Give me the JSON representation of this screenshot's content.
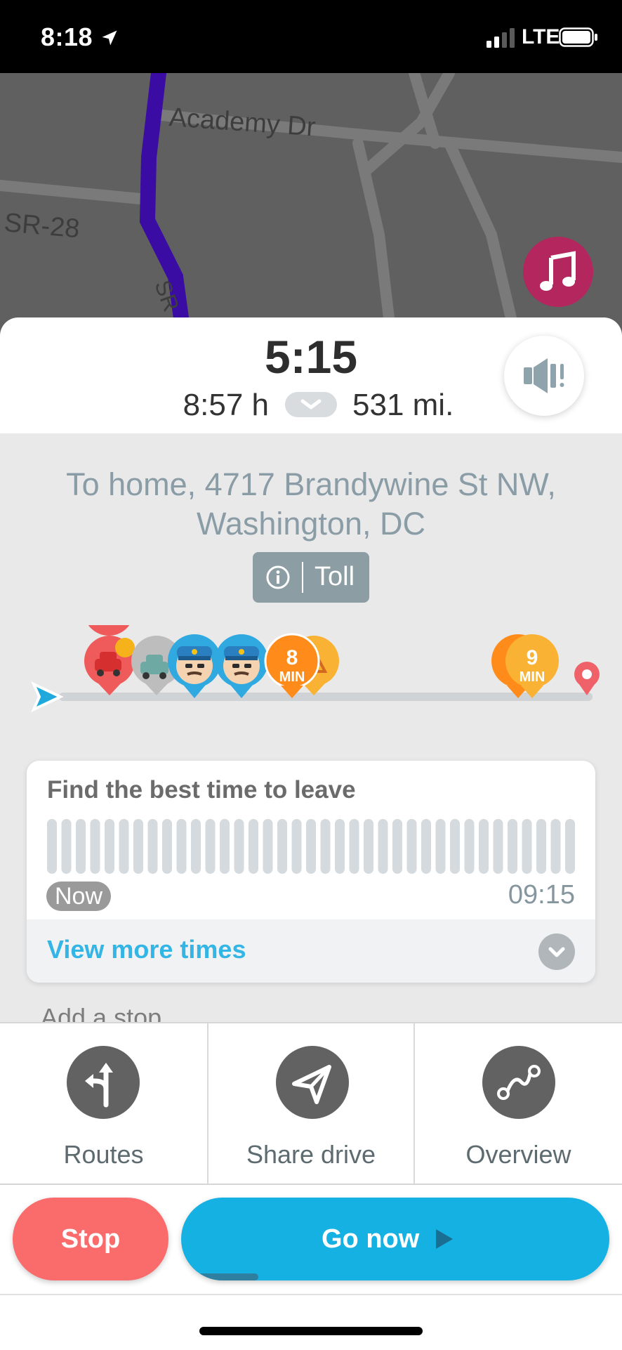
{
  "status_bar": {
    "time": "8:18",
    "network": "LTE"
  },
  "map": {
    "streets": [
      "Academy Dr",
      "SR-28",
      "SR"
    ],
    "music_icon": "music-note-icon"
  },
  "trip": {
    "arrival_time": "5:15",
    "duration": "8:57 h",
    "distance": "531 mi."
  },
  "destination": {
    "line1": "To home, 4717 Brandywine St NW,",
    "line2": "Washington, DC",
    "toll_label": "Toll"
  },
  "timeline": {
    "delays": [
      {
        "value": "8",
        "unit": "MIN"
      },
      {
        "value": "9",
        "unit": "MIN"
      }
    ],
    "event_icons": [
      "traffic-car-icon",
      "accident-car-icon",
      "police-icon",
      "police-icon",
      "hazard-icon",
      "destination-pin-icon"
    ]
  },
  "best_time": {
    "title": "Find the best time to leave",
    "start_label": "Now",
    "end_label": "09:15",
    "more_label": "View more times"
  },
  "add_stop": "Add a stop",
  "actions": [
    {
      "label": "Routes",
      "icon": "routes-icon"
    },
    {
      "label": "Share drive",
      "icon": "share-drive-icon"
    },
    {
      "label": "Overview",
      "icon": "overview-icon"
    }
  ],
  "buttons": {
    "stop": "Stop",
    "go": "Go now",
    "go_progress": 0.18
  },
  "colors": {
    "stop": "#fa6b6b",
    "go": "#16b1e3",
    "route": "#3a0ca3",
    "delay": "#ff8c1a"
  }
}
